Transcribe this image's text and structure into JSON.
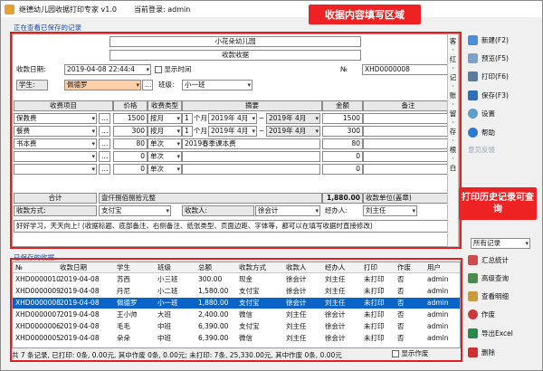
{
  "window": {
    "title": "继德幼儿园收据打印专家 v1.0",
    "login": "当前登录: admin"
  },
  "callouts": {
    "top": "收据内容填写区域",
    "right": "打印历史记录可查询"
  },
  "sections": {
    "current": "正在查看已保存的记录",
    "saved": "已保存的收据"
  },
  "receipt": {
    "school": "小花朵幼儿园",
    "type": "收款收据",
    "date_label": "收款日期:",
    "date_value": "2019-04-08 22:44:4",
    "show_time": "显示时间",
    "no_label": "№",
    "no_value": "XHD0000008",
    "student_label": "学生:",
    "student_value": "佩德罗",
    "class_label": "班级:",
    "class_value": "小一班"
  },
  "cols": {
    "item": "收费项目",
    "price": "价格",
    "ctype": "收费类型",
    "summary": "摘要",
    "amount": "金额",
    "note": "备注"
  },
  "items": [
    {
      "name": "保教费",
      "price": "1500",
      "type": "按月",
      "qty": "1",
      "unit": "个月",
      "from": "2019年 4月",
      "to": "2019年 4月",
      "amount": "1500"
    },
    {
      "name": "餐费",
      "price": "300",
      "type": "按月",
      "qty": "1",
      "unit": "个月",
      "from": "2019年 4月",
      "to": "2019年 4月",
      "amount": "300"
    },
    {
      "name": "书本费",
      "price": "80",
      "type": "单次",
      "qty": "",
      "unit": "",
      "from": "2019春季课本费",
      "to": "",
      "amount": "80"
    },
    {
      "name": "",
      "price": "0",
      "type": "单次",
      "qty": "",
      "unit": "",
      "from": "",
      "to": "",
      "amount": "0"
    },
    {
      "name": "",
      "price": "0",
      "type": "单次",
      "qty": "",
      "unit": "",
      "from": "",
      "to": "",
      "amount": "0"
    }
  ],
  "total": {
    "label": "合计",
    "words": "壹仟捌佰捌拾元整",
    "value": "1,880.00",
    "unit_label": "收款单位(盖章)"
  },
  "pay": {
    "method_label": "收款方式:",
    "method": "支付宝",
    "payee_label": "收款人:",
    "payee": "徐会计",
    "handler_label": "经办人:",
    "handler": "刘主任"
  },
  "remark": "好好学习，天天向上! (收据标题、底部备注、右侧备注、纸张类型、页面边距、字体等，都可以在填写收据时直接修改)",
  "side_text": "客 · 红 · 记 · 账 · 留 · 存 · 根 · 白",
  "buttons": [
    "新建(F2)",
    "预览(F5)",
    "打印(F6)",
    "保存(F3)",
    "设置",
    "帮助",
    "意见反馈"
  ],
  "filter": "所有记录",
  "hist_buttons": [
    "汇总统计",
    "高级查询",
    "查看明细",
    "作废",
    "导出Excel",
    "删除"
  ],
  "table": {
    "headers": [
      "№",
      "收款日期",
      "学生",
      "班级",
      "总额",
      "收款方式",
      "收款人",
      "经办人",
      "打印",
      "作废",
      "用户"
    ],
    "rows": [
      [
        "XHD0000010",
        "2019-04-08",
        "苏西",
        "小三班",
        "300.00",
        "现金",
        "徐会计",
        "刘主任",
        "未打印",
        "否",
        "admin"
      ],
      [
        "XHD0000009",
        "2019-04-08",
        "丹尼",
        "小二班",
        "1,580.00",
        "支付宝",
        "徐会计",
        "刘主任",
        "未打印",
        "否",
        "admin"
      ],
      [
        "XHD0000008",
        "2019-04-08",
        "佩德罗",
        "小一班",
        "1,880.00",
        "支付宝",
        "徐会计",
        "刘主任",
        "未打印",
        "否",
        "admin"
      ],
      [
        "XHD0000007",
        "2019-04-08",
        "王小帅",
        "大班",
        "2,400.00",
        "微信",
        "刘主任",
        "徐会计",
        "未打印",
        "否",
        "admin"
      ],
      [
        "XHD0000006",
        "2019-04-08",
        "毛毛",
        "中班",
        "6,390.00",
        "支付宝",
        "刘主任",
        "徐会计",
        "未打印",
        "否",
        "admin"
      ],
      [
        "XHD0000005",
        "2019-04-08",
        "朵朵",
        "中班",
        "6,390.00",
        "微信",
        "刘主任",
        "徐会计",
        "未打印",
        "否",
        "admin"
      ]
    ],
    "selected": 2
  },
  "status": "共 7 条记录, 已打印: 0条, 0.00元, 其中作废 0条, 0.00元; 未打印: 7条, 25,330.00元, 其中作废 0条, 0.00元",
  "show_void": "显示作废",
  "colors": {
    "accent": "#e02020",
    "select": "#0a64c8",
    "student_bg": "#ffd0a8"
  }
}
